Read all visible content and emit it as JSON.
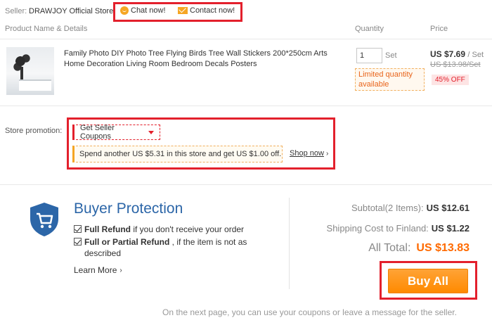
{
  "seller": {
    "label": "Seller:",
    "name": "DRAWJOY Official Store",
    "chat_label": "Chat now!",
    "contact_label": "Contact now!"
  },
  "table": {
    "headers": [
      "Product Name & Details",
      "Quantity",
      "Price"
    ]
  },
  "product": {
    "title": "Family Photo DIY Photo Tree Flying Birds Tree Wall Stickers 200*250cm Arts Home Decoration Living Room Bedroom Decals Posters",
    "quantity": "1",
    "quantity_unit": "Set",
    "limited_note": "Limited quantity available",
    "price": "US $7.69",
    "price_unit": "/ Set",
    "old_price": "US $13.98/Set",
    "discount": "45% OFF"
  },
  "promotion": {
    "label": "Store promotion:",
    "coupon_label": "Get Seller Coupons",
    "spend_text": "Spend another US $5.31 in this store and get US $1.00 off.",
    "shop_now": "Shop now"
  },
  "buyer_protection": {
    "title": "Buyer Protection",
    "line1_bold": "Full Refund",
    "line1_rest": " if you don't receive your order",
    "line2_bold": "Full or Partial Refund",
    "line2_rest": " , if the item is not as",
    "line2_cont": "described",
    "learn_more": "Learn More"
  },
  "totals": {
    "subtotal_label": "Subtotal(2 Items):",
    "subtotal_value": "US $12.61",
    "shipping_label": "Shipping Cost to Finland:",
    "shipping_value": "US $1.22",
    "all_total_label": "All Total:",
    "all_total_value": "US $13.83",
    "buy_all": "Buy All",
    "footnote": "On the next page, you can use your coupons or leave a message for the seller."
  },
  "colors": {
    "highlight_red": "#e3202c",
    "accent_orange": "#ff8a00",
    "brand_blue": "#2c66a8"
  }
}
